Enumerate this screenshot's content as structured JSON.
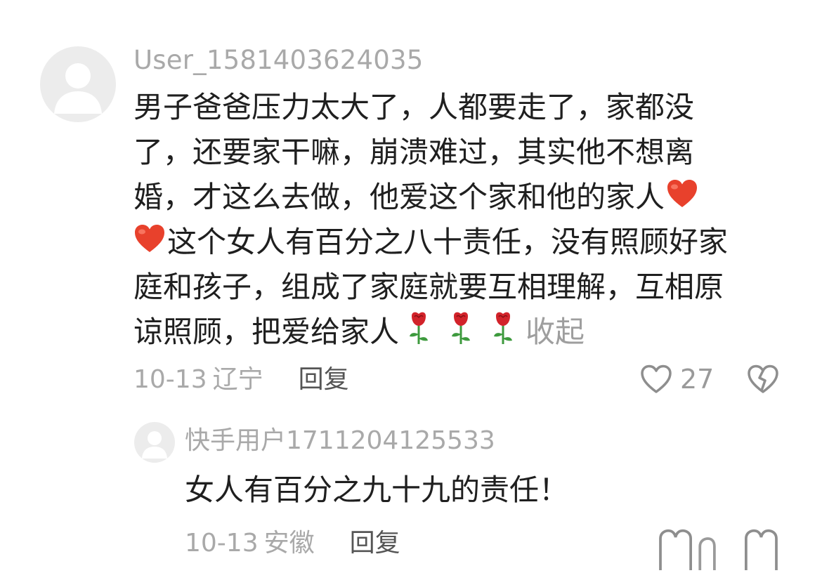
{
  "main_comment": {
    "username": "User_1581403624035",
    "lines": [
      "男子爸爸压力太大了，人都要走了，家都没",
      "了，还要家干嘛，崩溃难过，其实他不想离",
      "婚，才这么去做，他爱这个家和他的家人",
      "这个女人有百分之八十责任，没有照顾好家",
      "庭和孩子，组成了家庭就要互相理解，互相原",
      "谅照顾，把爱给家人"
    ],
    "emojis": {
      "heart": "heart-emoji",
      "rose": "rose-emoji"
    },
    "collapse_label": "收起",
    "date": "10-13",
    "location": "辽宁",
    "reply_label": "回复",
    "like_count": "27"
  },
  "reply_comment": {
    "username": "快手用户1711204125533",
    "text": "女人有百分之九十九的责任！",
    "date": "10-13",
    "location": "安徽",
    "reply_label": "回复"
  },
  "colors": {
    "muted_text": "#a9a9a9",
    "body_text": "#1f1f1f",
    "reply_action": "#555555",
    "heart_red": "#e8412c",
    "rose_red": "#d2232a",
    "rose_green": "#3d9a3d"
  }
}
